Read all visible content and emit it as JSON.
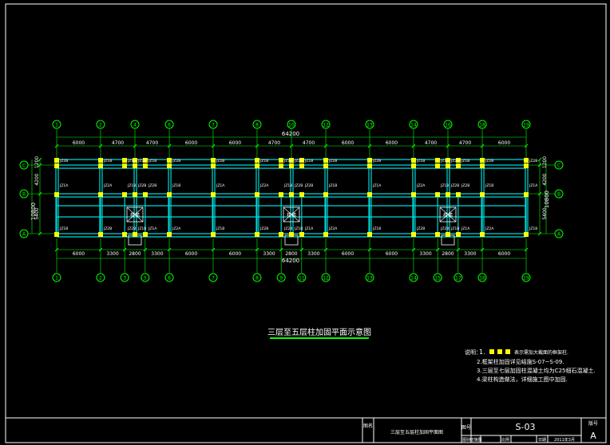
{
  "drawing": {
    "title": "三层至五层柱加固平面示意图",
    "dim_total_top": "64200",
    "dim_total_bottom": "64200",
    "top_axes": [
      "1",
      "2",
      "4",
      "6",
      "7",
      "8",
      "10",
      "12",
      "13",
      "14",
      "16",
      "18",
      "19"
    ],
    "bottom_axes": [
      "1",
      "2",
      "3",
      "5",
      "6",
      "7",
      "8",
      "9",
      "11",
      "12",
      "13",
      "14",
      "15",
      "17",
      "18",
      "19"
    ],
    "top_dims": [
      "6000",
      "4700",
      "4700",
      "6000",
      "6000",
      "4700",
      "4700",
      "6000",
      "6000",
      "4700",
      "4700",
      "6000"
    ],
    "bottom_dims": [
      "6000",
      "3300",
      "2800",
      "3300",
      "6000",
      "6000",
      "3300",
      "2800",
      "3300",
      "6000",
      "6000",
      "3300",
      "2800",
      "3300",
      "6000"
    ],
    "row_axes": [
      "C",
      "B",
      "A"
    ],
    "left_dims": [
      "1200",
      "4200",
      "5400"
    ],
    "left_total": "10800",
    "right_dims": [
      "1200",
      "4200",
      "5400"
    ],
    "right_total": "10800",
    "column_tags": [
      "JZ2B",
      "JZ1B",
      "JZ1A",
      "JZ2A",
      "JZ1B",
      "JZ2B"
    ],
    "stair_label": "楼梯"
  },
  "notes": {
    "label": "说明：",
    "n1_num": "1.",
    "n1_text": "表示需加大截面的框架柱.",
    "n2": "2.框架柱加固详见结施S-07~S-09.",
    "n3": "3.三层至七层加固柱混凝土均为C25细石混凝土.",
    "n4": "4.梁柱构造做法，详细施工图中加固."
  },
  "title_block": {
    "name_label": "图名",
    "name_value": "三层至五层柱加固平面图",
    "no_label": "图号",
    "no_value": "S-03",
    "version_label": "版号",
    "version_value": "A",
    "row2_a": "图别",
    "row2_b": "结施图",
    "row2_c": "比例",
    "row2_d": "日期",
    "row2_e": "2011年3月"
  }
}
